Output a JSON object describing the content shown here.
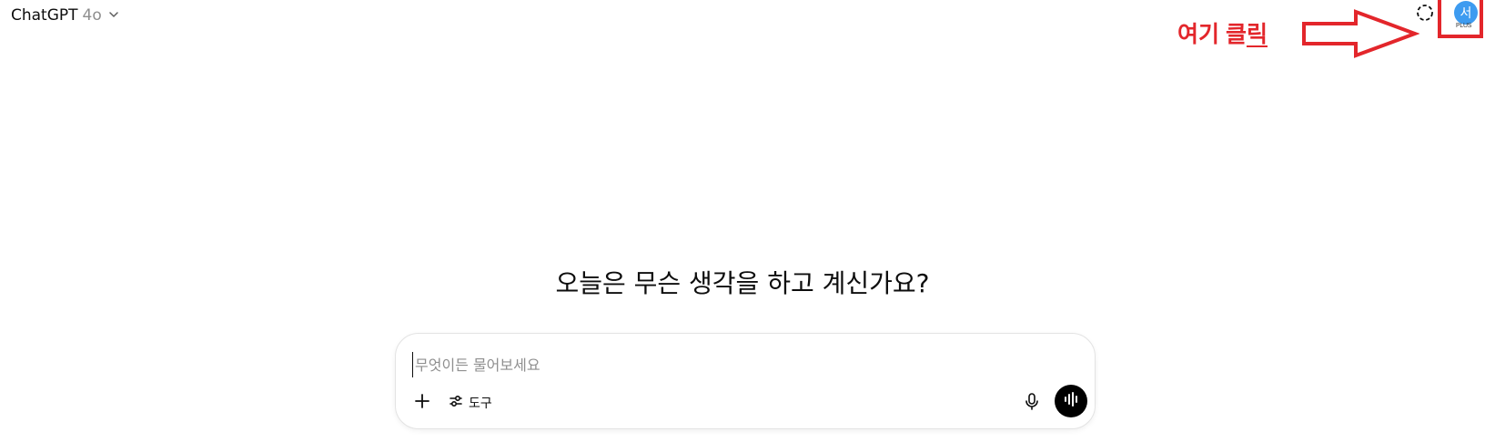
{
  "header": {
    "model_name": "ChatGPT",
    "model_version": "4o",
    "avatar_initial": "서",
    "plan_badge": "PLUS"
  },
  "annotation": {
    "text_main": "여기 클",
    "text_underlined": "릭",
    "color": "#e3262b"
  },
  "main": {
    "greeting": "오늘은 무슨 생각을 하고 계신가요?"
  },
  "composer": {
    "placeholder": "무엇이든 물어보세요",
    "value": "",
    "tools_label": "도구"
  },
  "icons": {
    "model_dropdown": "chevron-down-icon",
    "temporary_chat": "dashed-circle-icon",
    "attach": "plus-icon",
    "tools": "sliders-icon",
    "dictate": "microphone-icon",
    "voice_mode": "voice-wave-icon"
  },
  "colors": {
    "avatar_bg": "#3d9bf0",
    "voice_button_bg": "#000000",
    "annotation": "#e3262b"
  }
}
